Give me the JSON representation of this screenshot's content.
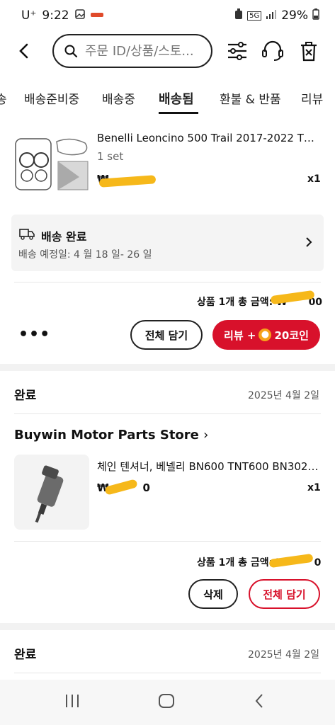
{
  "status_bar": {
    "carrier": "U⁺",
    "time": "9:22",
    "network": "5G",
    "battery": "29%"
  },
  "header": {
    "search_placeholder": "주문 ID/상품/스토..."
  },
  "tabs": [
    {
      "label": "송"
    },
    {
      "label": "배송준비중"
    },
    {
      "label": "배송중"
    },
    {
      "label": "배송됨"
    },
    {
      "label": "환불 & 반품"
    },
    {
      "label": "리뷰"
    }
  ],
  "order1": {
    "product_title": "Benelli Leoncino 500 Trail 2017-2022 TRK5...",
    "variant": "1 set",
    "price": "₩",
    "quantity": "x1",
    "delivery_status": "배송 완료",
    "delivery_estimate": "배송 예정일: 4 월 18 일- 26 일",
    "total_label": "상품 1개 총 금액: ₩",
    "total_suffix": "00",
    "btn_add_all": "전체 담기",
    "btn_review": "리뷰 +",
    "btn_review_coins": "20코인"
  },
  "order2": {
    "status": "완료",
    "date": "2025년 4월 2일",
    "store": "Buywin Motor Parts Store",
    "product_title": "체인 텐셔너, 베넬리 BN600 TNT600 BN302 T...",
    "price": "₩",
    "price_suffix": "0",
    "quantity": "x1",
    "total_label": "상품 1개 총 금액: ₩",
    "total_suffix": "0",
    "btn_delete": "삭제",
    "btn_add_all": "전체 담기"
  },
  "order3": {
    "status": "완료",
    "date": "2025년 4월 2일"
  }
}
